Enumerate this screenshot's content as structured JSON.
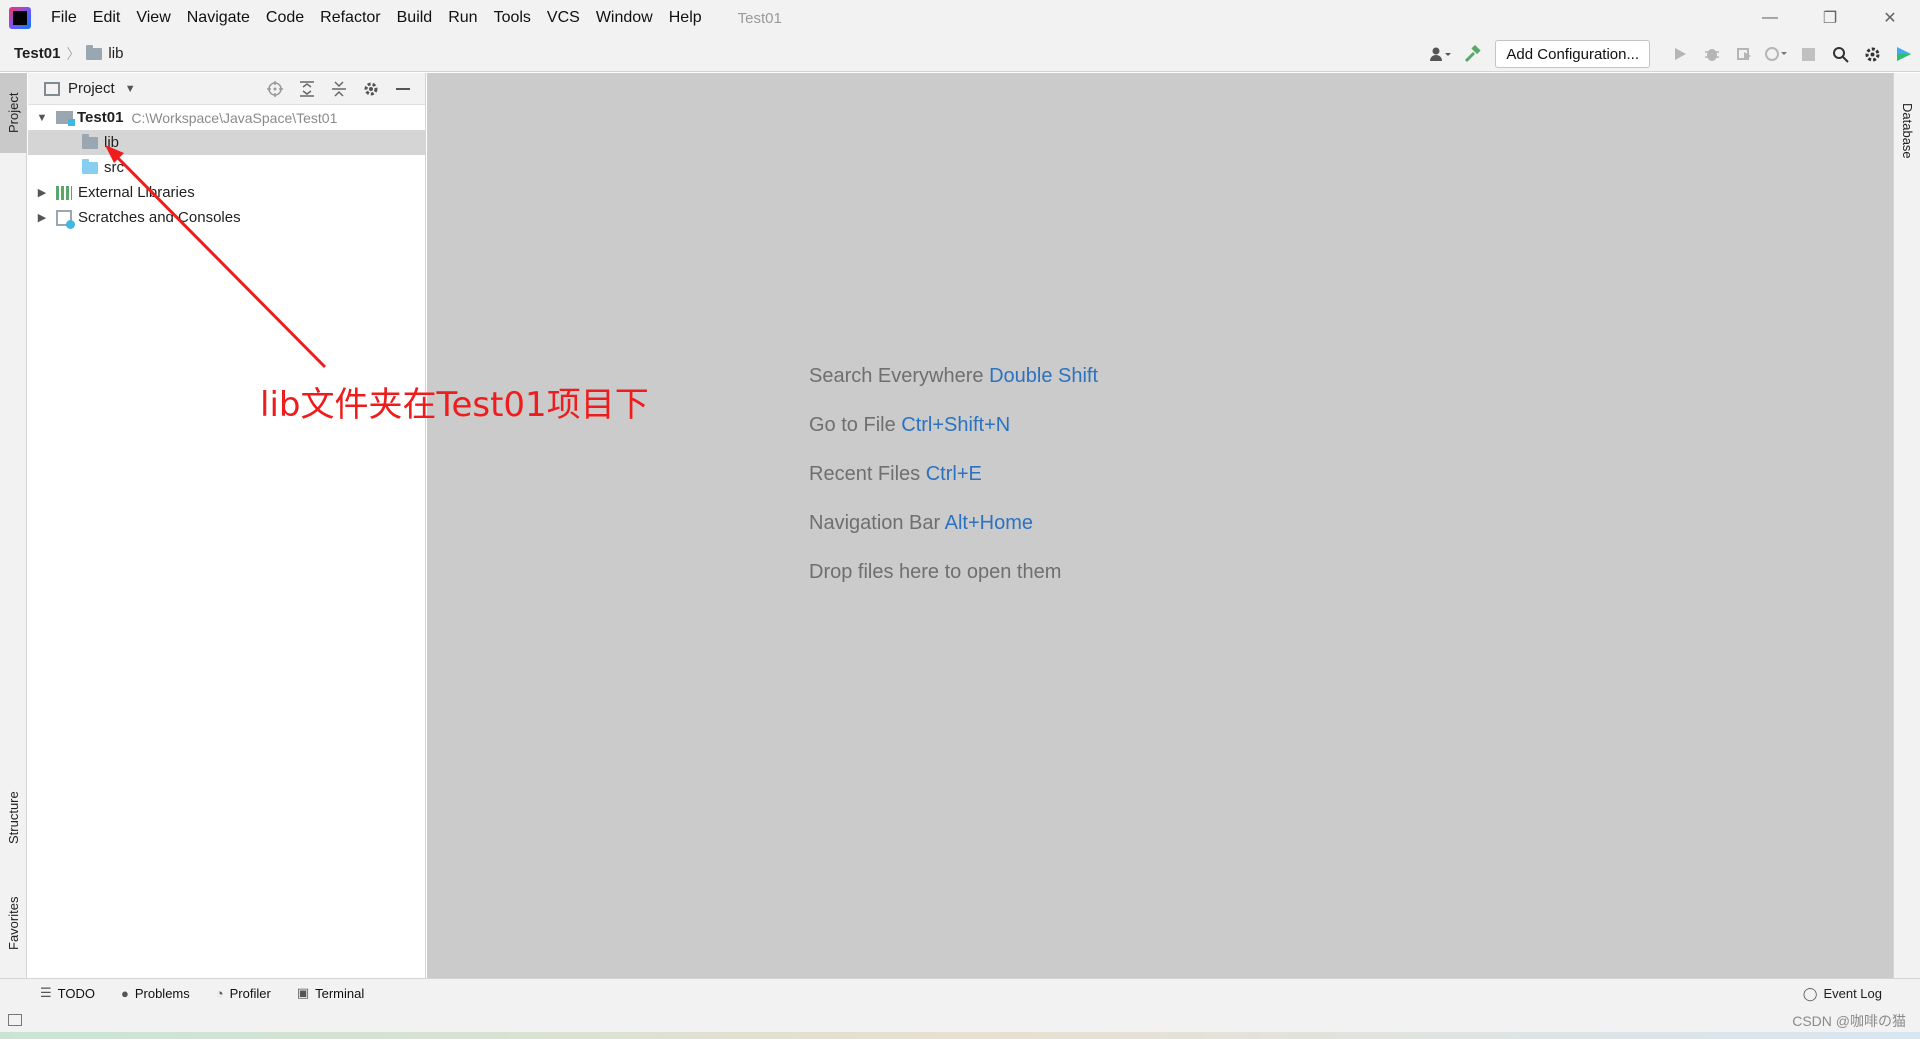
{
  "titlebar": {
    "menu": [
      "File",
      "Edit",
      "View",
      "Navigate",
      "Code",
      "Refactor",
      "Build",
      "Run",
      "Tools",
      "VCS",
      "Window",
      "Help"
    ],
    "window_title": "Test01",
    "controls": {
      "minimize": "—",
      "restore": "❐",
      "close": "✕"
    }
  },
  "navbar": {
    "root": "Test01",
    "separator": "〉",
    "child": "lib",
    "add_configuration": "Add Configuration..."
  },
  "left_tabs": {
    "project": "Project",
    "structure": "Structure",
    "favorites": "Favorites"
  },
  "right_tabs": {
    "database": "Database"
  },
  "project_panel": {
    "title": "Project",
    "tree": {
      "root": {
        "name": "Test01",
        "path": "C:\\Workspace\\JavaSpace\\Test01"
      },
      "lib": "lib",
      "src": "src",
      "external_libraries": "External Libraries",
      "scratches": "Scratches and Consoles"
    }
  },
  "editor_hints": [
    {
      "text": "Search Everywhere",
      "key": "Double Shift"
    },
    {
      "text": "Go to File",
      "key": "Ctrl+Shift+N"
    },
    {
      "text": "Recent Files",
      "key": "Ctrl+E"
    },
    {
      "text": "Navigation Bar",
      "key": "Alt+Home"
    },
    {
      "text": "Drop files here to open them",
      "key": ""
    }
  ],
  "bottom_tabs": {
    "todo": "TODO",
    "problems": "Problems",
    "profiler": "Profiler",
    "terminal": "Terminal",
    "event_log": "Event Log"
  },
  "annotation": {
    "text": "lib文件夹在Test01项目下",
    "color": "#ee1c1c"
  },
  "watermark": "CSDN @咖啡の猫",
  "colors": {
    "accent_key": "#2b72c0",
    "annotation": "#ee1c1c",
    "editor_bg": "#cbcbcb"
  }
}
